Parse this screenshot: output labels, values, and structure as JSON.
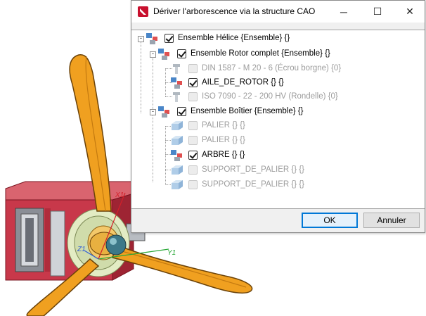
{
  "viewport": {
    "axes": [
      {
        "label": "X1",
        "color": "#d2202a"
      },
      {
        "label": "Y1",
        "color": "#2aa838"
      },
      {
        "label": "Z1",
        "color": "#2d5bd8"
      }
    ],
    "colors": {
      "propeller": "#f0a020",
      "housing": "#c8384a",
      "hub": "#3c7888"
    }
  },
  "dialog": {
    "title": "Dériver l'arborescence via la structure CAO",
    "controls": {
      "minimize": "─",
      "maximize": "☐",
      "close": "✕"
    },
    "tree": [
      {
        "label": "Ensemble Hélice {Ensemble} {}",
        "checked": true,
        "enabled": true,
        "icon": "assembly-icon"
      },
      {
        "label": "Ensemble Rotor complet {Ensemble} {}",
        "checked": true,
        "enabled": true,
        "icon": "assembly-icon"
      },
      {
        "label": "DIN 1587 - M 20 - 6 (Écrou borgne) {0}",
        "checked": false,
        "enabled": false,
        "icon": "standard-part-icon"
      },
      {
        "label": "AILE_DE_ROTOR {} {}",
        "checked": true,
        "enabled": true,
        "icon": "assembly-icon"
      },
      {
        "label": "ISO 7090 - 22 - 200 HV (Rondelle) {0}",
        "checked": false,
        "enabled": false,
        "icon": "standard-part-icon"
      },
      {
        "label": "Ensemble Boîtier {Ensemble} {}",
        "checked": true,
        "enabled": true,
        "icon": "assembly-icon"
      },
      {
        "label": "PALIER {} {}",
        "checked": false,
        "enabled": false,
        "icon": "part-icon"
      },
      {
        "label": "PALIER {} {}",
        "checked": false,
        "enabled": false,
        "icon": "part-icon"
      },
      {
        "label": "ARBRE {} {}",
        "checked": true,
        "enabled": true,
        "icon": "assembly-icon"
      },
      {
        "label": "SUPPORT_DE_PALIER {} {}",
        "checked": false,
        "enabled": false,
        "icon": "part-icon"
      },
      {
        "label": "SUPPORT_DE_PALIER {} {}",
        "checked": false,
        "enabled": false,
        "icon": "part-icon"
      }
    ],
    "buttons": {
      "ok": "OK",
      "cancel": "Annuler"
    }
  }
}
